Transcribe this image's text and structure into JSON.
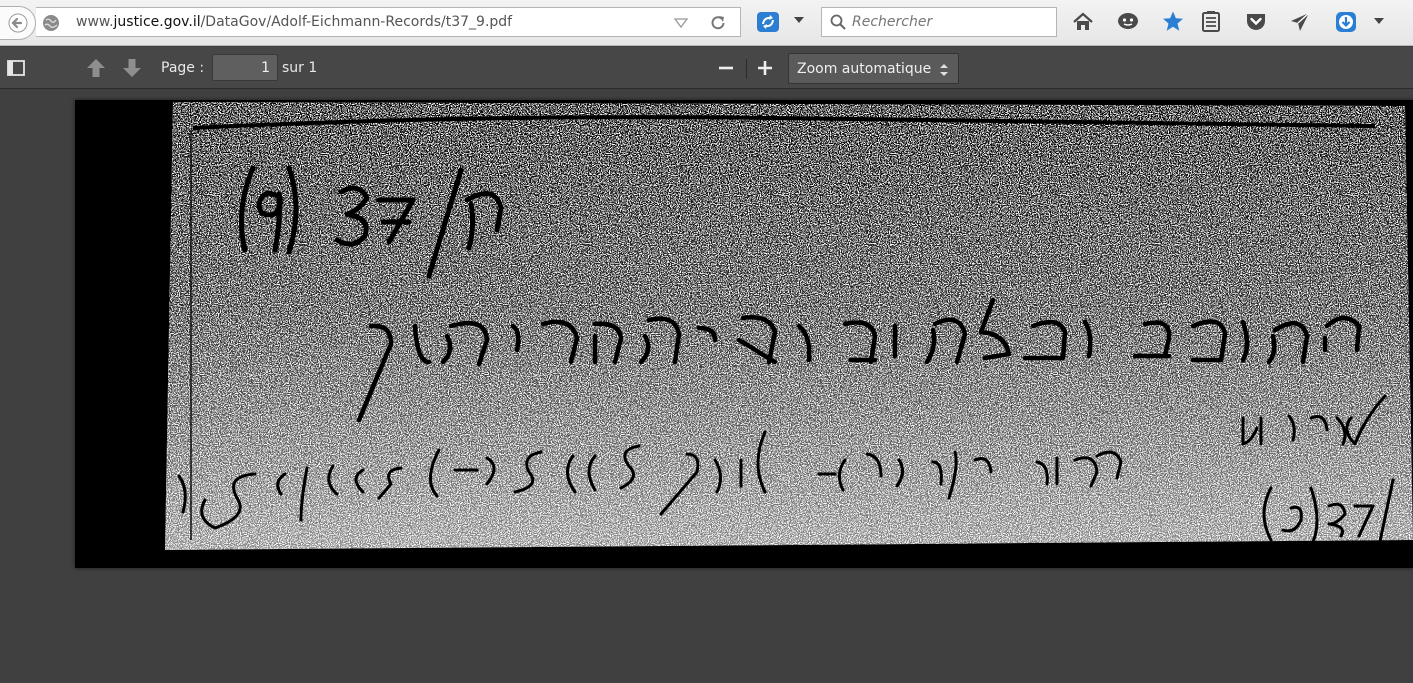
{
  "browser": {
    "url_prefix": "www.",
    "url_domain": "justice.gov.il",
    "url_path": "/DataGov/Adolf-Eichmann-Records/t37_9.pdf",
    "search_placeholder": "Rechercher",
    "icons": [
      "back-arrow-icon",
      "globe-icon",
      "url-dropdown-icon",
      "reload-icon",
      "sync-icon",
      "chevron-down-icon",
      "search-icon",
      "home-icon",
      "chat-icon",
      "bookmark-star-icon",
      "reading-list-icon",
      "pocket-icon",
      "send-icon",
      "download-icon",
      "menu-chevron-icon"
    ],
    "accent_color": "#2a7fd4"
  },
  "pdf_toolbar": {
    "page_label": "Page :",
    "page_value": "1",
    "page_total": "sur 1",
    "zoom_value": "Zoom automatique",
    "icons": [
      "sidebar-toggle-icon",
      "previous-page-icon",
      "next-page-icon",
      "zoom-out-icon",
      "zoom-in-icon"
    ]
  },
  "document": {
    "description": "Handwritten Hebrew archival note (scanned, high-contrast)"
  }
}
